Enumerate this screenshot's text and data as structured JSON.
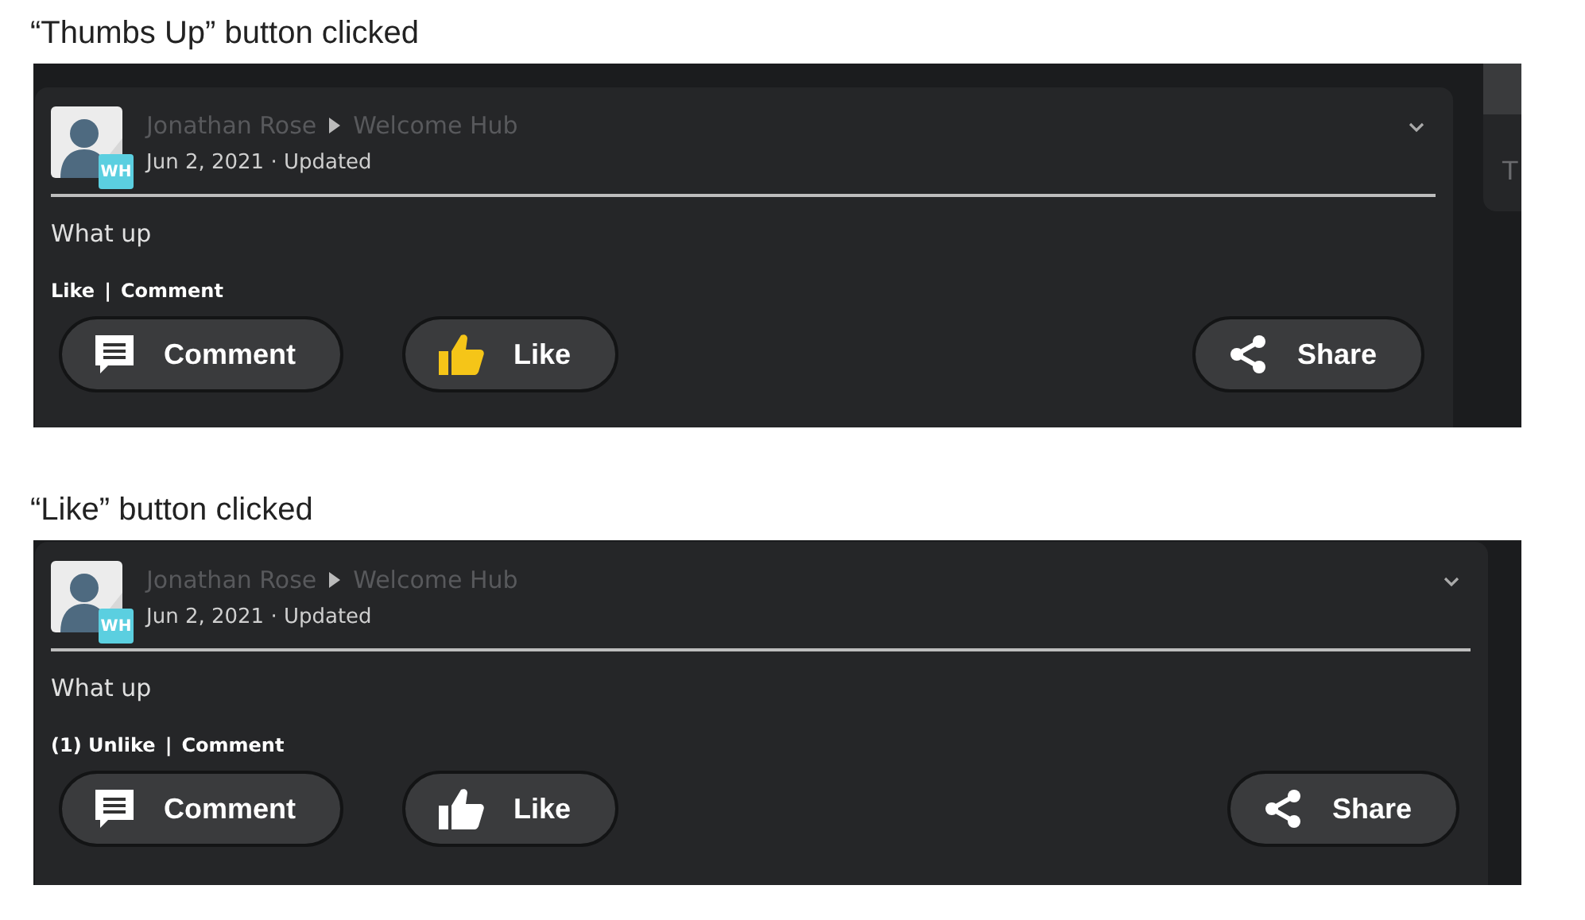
{
  "panels": [
    {
      "caption": "“Thumbs Up” button clicked",
      "side": {
        "text": "T"
      },
      "post": {
        "author": "Jonathan Rose",
        "hub": "Welcome Hub",
        "badge": "WH",
        "date": "Jun 2, 2021 · Updated",
        "body": "What up",
        "actions": [
          {
            "label": "Like"
          },
          {
            "label": "Comment"
          }
        ],
        "separator": "|",
        "buttons": [
          {
            "kind": "comment",
            "label": "Comment"
          },
          {
            "kind": "like",
            "label": "Like",
            "selected": true
          },
          {
            "kind": "share",
            "label": "Share"
          }
        ]
      }
    },
    {
      "caption": "“Like” button clicked",
      "post": {
        "author": "Jonathan Rose",
        "hub": "Welcome Hub",
        "badge": "WH",
        "date": "Jun 2, 2021 · Updated",
        "body": "What up",
        "actions": [
          {
            "label": "(1) Unlike"
          },
          {
            "label": "Comment"
          }
        ],
        "separator": "|",
        "buttons": [
          {
            "kind": "comment",
            "label": "Comment"
          },
          {
            "kind": "like",
            "label": "Like",
            "selected": false
          },
          {
            "kind": "share",
            "label": "Share"
          }
        ]
      }
    }
  ]
}
